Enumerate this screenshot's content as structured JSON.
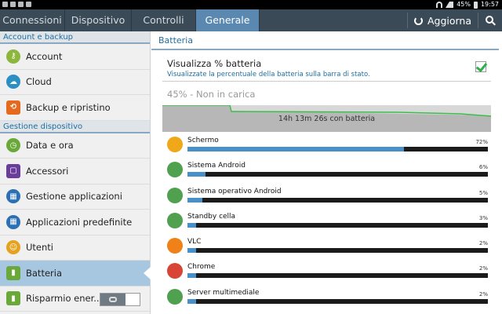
{
  "statusbar": {
    "battery": "45%",
    "time": "19:57"
  },
  "tabs": [
    {
      "label": "Connessioni"
    },
    {
      "label": "Dispositivo"
    },
    {
      "label": "Controlli"
    },
    {
      "label": "Generale"
    }
  ],
  "toolbar": {
    "refresh_label": "Aggiorna",
    "search_icon": "search-icon",
    "refresh_icon": "refresh-icon"
  },
  "sidebar": {
    "section1": "Account e backup",
    "section2": "Gestione dispositivo",
    "items": [
      {
        "label": "Account",
        "icon": "key-icon",
        "color": "#8db63c"
      },
      {
        "label": "Cloud",
        "icon": "cloud-icon",
        "color": "#2b8fc4"
      },
      {
        "label": "Backup e ripristino",
        "icon": "backup-icon",
        "color": "#e66a1e"
      },
      {
        "label": "Data e ora",
        "icon": "clock-icon",
        "color": "#6aa83a"
      },
      {
        "label": "Accessori",
        "icon": "accessories-icon",
        "color": "#6a3d9a"
      },
      {
        "label": "Gestione applicazioni",
        "icon": "apps-grid-icon",
        "color": "#2b6fb4"
      },
      {
        "label": "Applicazioni predefinite",
        "icon": "default-apps-icon",
        "color": "#2b6fb4"
      },
      {
        "label": "Utenti",
        "icon": "user-icon",
        "color": "#e6a21e"
      },
      {
        "label": "Batteria",
        "icon": "battery-icon",
        "color": "#6aa83a"
      },
      {
        "label": "Risparmio ener...",
        "icon": "power-saving-icon",
        "color": "#6aa83a"
      }
    ]
  },
  "main": {
    "title": "Batteria",
    "option_title": "Visualizza % batteria",
    "option_sub": "Visualizzate la percentuale della batteria sulla barra di stato.",
    "option_checked": true,
    "battery_status": "45% - Non in carica",
    "graph_label": "14h 13m 26s con batteria",
    "apps": [
      {
        "name": "Schermo",
        "pct": "72%",
        "value": 0.72,
        "icon": "screen-brightness-icon",
        "color": "#f0a818"
      },
      {
        "name": "Sistema Android",
        "pct": "6%",
        "value": 0.06,
        "icon": "android-system-icon",
        "color": "#4fa04f"
      },
      {
        "name": "Sistema operativo Android",
        "pct": "5%",
        "value": 0.05,
        "icon": "android-os-icon",
        "color": "#4fa04f"
      },
      {
        "name": "Standby cella",
        "pct": "3%",
        "value": 0.03,
        "icon": "cell-standby-icon",
        "color": "#4fa04f"
      },
      {
        "name": "VLC",
        "pct": "2%",
        "value": 0.02,
        "icon": "vlc-icon",
        "color": "#f08018"
      },
      {
        "name": "Chrome",
        "pct": "2%",
        "value": 0.02,
        "icon": "chrome-icon",
        "color": "#d84436"
      },
      {
        "name": "Server multimediale",
        "pct": "2%",
        "value": 0.02,
        "icon": "media-server-icon",
        "color": "#4fa04f"
      }
    ]
  }
}
